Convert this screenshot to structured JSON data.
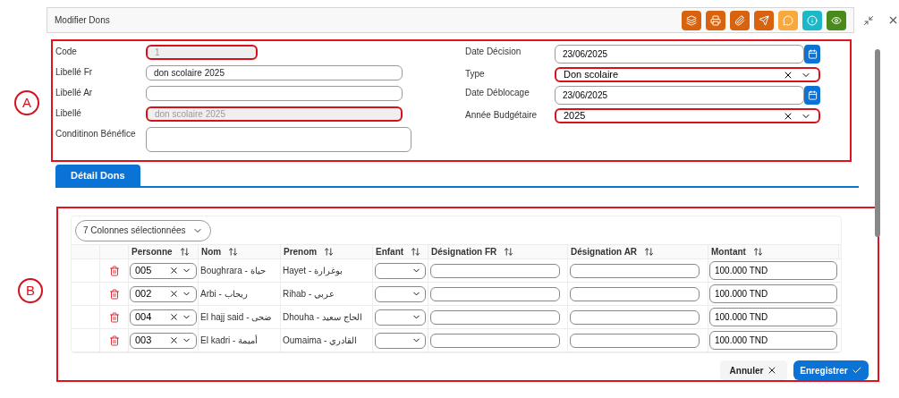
{
  "annotations": [
    {
      "label": "A"
    },
    {
      "label": "B"
    }
  ],
  "window": {
    "title": "Modifier Dons",
    "actions": [
      {
        "color": "#d9620f"
      },
      {
        "color": "#d9620f"
      },
      {
        "color": "#d9620f"
      },
      {
        "color": "#d9620f"
      },
      {
        "color": "#f9a83b"
      },
      {
        "color": "#1bb8c8"
      },
      {
        "color": "#4a8a1c"
      }
    ]
  },
  "form_left": [
    {
      "label": "Code",
      "value": "1",
      "disabled": true,
      "invalid": true,
      "kind": "input"
    },
    {
      "label": "Libellé Fr",
      "value": "don scolaire 2025",
      "disabled": false,
      "invalid": false,
      "kind": "input"
    },
    {
      "label": "Libellé Ar",
      "disabled": false,
      "invalid": false,
      "kind": "input"
    },
    {
      "label": "Libellé",
      "value": "don scolaire 2025",
      "disabled": true,
      "invalid": true,
      "kind": "input"
    },
    {
      "label": "Conditinon Bénéfice",
      "disabled": false,
      "invalid": false,
      "kind": "textarea"
    }
  ],
  "form_right": [
    {
      "label": "Date Décision",
      "value": "23/06/2025",
      "invalid": false,
      "kind": "date"
    },
    {
      "label": "Type",
      "value": "Don scolaire",
      "invalid": true,
      "kind": "select"
    },
    {
      "label": "Date Déblocage",
      "value": "23/06/2025",
      "invalid": false,
      "kind": "date"
    },
    {
      "label": "Année Budgétaire",
      "value": "2025",
      "invalid": true,
      "kind": "select"
    }
  ],
  "tabs": [
    {
      "label": "Détail Dons",
      "selected": true
    }
  ],
  "table": {
    "column_picker": "7 Colonnes sélectionnées",
    "columns": [
      "Personne",
      "Nom",
      "Prenom",
      "Enfant",
      "Désignation FR",
      "Désignation AR",
      "Montant"
    ],
    "rows": [
      {
        "personne": "005",
        "nom": "Boughrara - حياة",
        "prenom": "Hayet - بوغرارة",
        "montant": "100.000 TND"
      },
      {
        "personne": "002",
        "nom": "Arbi - ريحاب",
        "prenom": "Rihab - عربي",
        "montant": "100.000 TND"
      },
      {
        "personne": "004",
        "nom": "El hajj said - ضحى",
        "prenom": "Dhouha - الحاج سعيد",
        "montant": "100.000 TND"
      },
      {
        "personne": "003",
        "nom": "El kadri - أميمة",
        "prenom": "Oumaima - القادري",
        "montant": "100.000 TND"
      }
    ]
  },
  "buttons": {
    "cancel": "Annuler",
    "save": "Enregistrer"
  }
}
